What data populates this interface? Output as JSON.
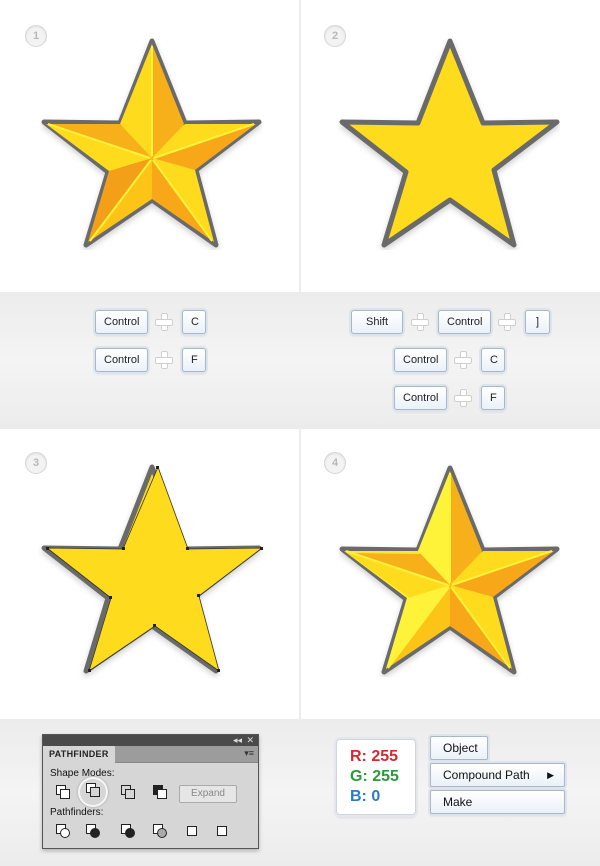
{
  "steps": [
    {
      "number": "1"
    },
    {
      "number": "2"
    },
    {
      "number": "3"
    },
    {
      "number": "4"
    }
  ],
  "keys": {
    "control": "Control",
    "c": "C",
    "f": "F",
    "shift": "Shift",
    "bracket": "]"
  },
  "pathfinder": {
    "title": "PATHFINDER",
    "shape_modes_label": "Shape Modes:",
    "pathfinders_label": "Pathfinders:",
    "expand_label": "Expand",
    "collapse_glyph": "◂◂",
    "close_glyph": "✕",
    "menu_glyph": "▾≡"
  },
  "color": {
    "r_label": "R: 255",
    "g_label": "G: 255",
    "b_label": "B: 0",
    "r_color": "#d3292f",
    "g_color": "#2a9a3c",
    "b_color": "#2a7cc4"
  },
  "menu": {
    "object": "Object",
    "compound_path": "Compound Path",
    "make": "Make",
    "arrow_glyph": "▶"
  },
  "star_colors": {
    "outline": "#6a6a6a",
    "fill": "#fedb1c",
    "light": "#fff33a",
    "orange": "#f7a718",
    "mid": "#fcc417"
  }
}
